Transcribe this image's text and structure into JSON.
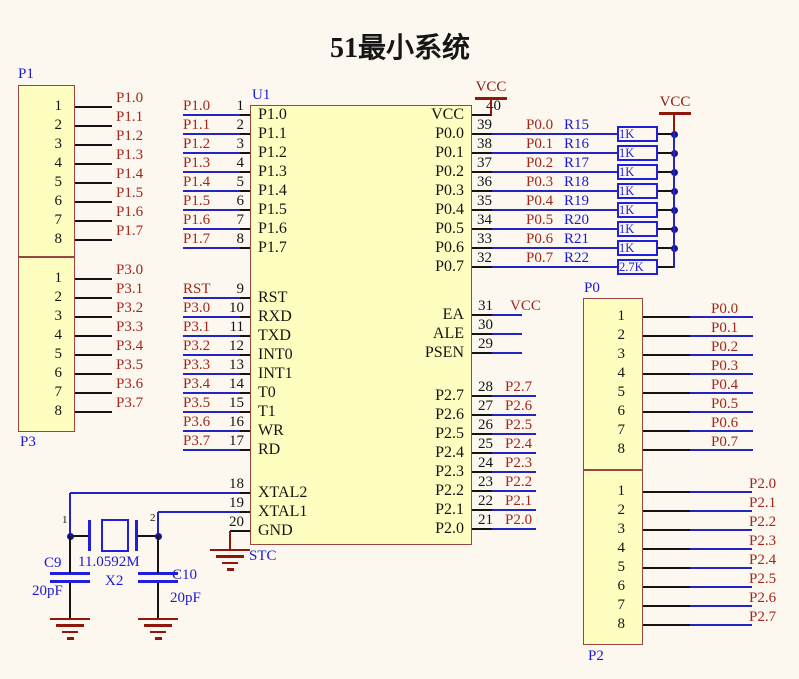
{
  "title": "51最小系统",
  "colors": {
    "background": "#FCF8F0",
    "component_fill": "#FEFEC0",
    "component_border": "#9A4640",
    "wire_blue": "#2424C0",
    "pin_black": "#141414",
    "net_label_red": "#A3261B",
    "designator_blue": "#1A1AD2",
    "power_red": "#8F170C",
    "junction_dot": "#16168E",
    "resistor_blue": "#2020DC",
    "text": "#141414"
  },
  "power": {
    "vcc_label": "VCC"
  },
  "chip": {
    "designator": "U1",
    "part_value": "STC",
    "left_groups": [
      [
        {
          "num": "1",
          "name": "P1.0",
          "net": "P1.0"
        },
        {
          "num": "2",
          "name": "P1.1",
          "net": "P1.1"
        },
        {
          "num": "3",
          "name": "P1.2",
          "net": "P1.2"
        },
        {
          "num": "4",
          "name": "P1.3",
          "net": "P1.3"
        },
        {
          "num": "5",
          "name": "P1.4",
          "net": "P1.4"
        },
        {
          "num": "6",
          "name": "P1.5",
          "net": "P1.5"
        },
        {
          "num": "7",
          "name": "P1.6",
          "net": "P1.6"
        },
        {
          "num": "8",
          "name": "P1.7",
          "net": "P1.7"
        }
      ],
      [
        {
          "num": "9",
          "name": "RST",
          "net": "RST"
        },
        {
          "num": "10",
          "name": "RXD",
          "net": "P3.0"
        },
        {
          "num": "11",
          "name": "TXD",
          "net": "P3.1"
        },
        {
          "num": "12",
          "name": "INT0",
          "net": "P3.2"
        },
        {
          "num": "13",
          "name": "INT1",
          "net": "P3.3"
        },
        {
          "num": "14",
          "name": "T0",
          "net": "P3.4"
        },
        {
          "num": "15",
          "name": "T1",
          "net": "P3.5"
        },
        {
          "num": "16",
          "name": "WR",
          "net": "P3.6"
        },
        {
          "num": "17",
          "name": "RD",
          "net": "P3.7"
        }
      ],
      [
        {
          "num": "18",
          "name": "XTAL2"
        },
        {
          "num": "19",
          "name": "XTAL1"
        },
        {
          "num": "20",
          "name": "GND"
        }
      ]
    ],
    "right_groups": [
      [
        {
          "num": "40",
          "name": "VCC"
        },
        {
          "num": "39",
          "name": "P0.0"
        },
        {
          "num": "38",
          "name": "P0.1"
        },
        {
          "num": "37",
          "name": "P0.2"
        },
        {
          "num": "36",
          "name": "P0.3"
        },
        {
          "num": "35",
          "name": "P0.4"
        },
        {
          "num": "34",
          "name": "P0.5"
        },
        {
          "num": "33",
          "name": "P0.6"
        },
        {
          "num": "32",
          "name": "P0.7"
        }
      ],
      [
        {
          "num": "31",
          "name": "EA",
          "net": "VCC"
        },
        {
          "num": "30",
          "name": "ALE"
        },
        {
          "num": "29",
          "name": "PSEN"
        }
      ],
      [
        {
          "num": "28",
          "name": "P2.7",
          "net": "P2.7"
        },
        {
          "num": "27",
          "name": "P2.6",
          "net": "P2.6"
        },
        {
          "num": "26",
          "name": "P2.5",
          "net": "P2.5"
        },
        {
          "num": "25",
          "name": "P2.4",
          "net": "P2.4"
        },
        {
          "num": "24",
          "name": "P2.3",
          "net": "P2.3"
        },
        {
          "num": "23",
          "name": "P2.2",
          "net": "P2.2"
        },
        {
          "num": "22",
          "name": "P2.1",
          "net": "P2.1"
        },
        {
          "num": "21",
          "name": "P2.0",
          "net": "P2.0"
        }
      ]
    ]
  },
  "resistors": [
    {
      "ref": "R15",
      "value": "1K",
      "net": "P0.0"
    },
    {
      "ref": "R16",
      "value": "1K",
      "net": "P0.1"
    },
    {
      "ref": "R17",
      "value": "1K",
      "net": "P0.2"
    },
    {
      "ref": "R18",
      "value": "1K",
      "net": "P0.3"
    },
    {
      "ref": "R19",
      "value": "1K",
      "net": "P0.4"
    },
    {
      "ref": "R20",
      "value": "1K",
      "net": "P0.5"
    },
    {
      "ref": "R21",
      "value": "1K",
      "net": "P0.6"
    },
    {
      "ref": "R22",
      "value": "2.7K",
      "net": "P0.7"
    }
  ],
  "connectors": [
    {
      "designator": "P1",
      "pins": [
        {
          "num": "1",
          "net": "P1.0"
        },
        {
          "num": "2",
          "net": "P1.1"
        },
        {
          "num": "3",
          "net": "P1.2"
        },
        {
          "num": "4",
          "net": "P1.3"
        },
        {
          "num": "5",
          "net": "P1.4"
        },
        {
          "num": "6",
          "net": "P1.5"
        },
        {
          "num": "7",
          "net": "P1.6"
        },
        {
          "num": "8",
          "net": "P1.7"
        }
      ]
    },
    {
      "designator": "P3",
      "pins": [
        {
          "num": "1",
          "net": "P3.0"
        },
        {
          "num": "2",
          "net": "P3.1"
        },
        {
          "num": "3",
          "net": "P3.2"
        },
        {
          "num": "4",
          "net": "P3.3"
        },
        {
          "num": "5",
          "net": "P3.4"
        },
        {
          "num": "6",
          "net": "P3.5"
        },
        {
          "num": "7",
          "net": "P3.6"
        },
        {
          "num": "8",
          "net": "P3.7"
        }
      ]
    },
    {
      "designator": "P0",
      "pins": [
        {
          "num": "1",
          "net": "P0.0"
        },
        {
          "num": "2",
          "net": "P0.1"
        },
        {
          "num": "3",
          "net": "P0.2"
        },
        {
          "num": "4",
          "net": "P0.3"
        },
        {
          "num": "5",
          "net": "P0.4"
        },
        {
          "num": "6",
          "net": "P0.5"
        },
        {
          "num": "7",
          "net": "P0.6"
        },
        {
          "num": "8",
          "net": "P0.7"
        }
      ]
    },
    {
      "designator": "P2",
      "pins": [
        {
          "num": "1",
          "net": "P2.0"
        },
        {
          "num": "2",
          "net": "P2.1"
        },
        {
          "num": "3",
          "net": "P2.2"
        },
        {
          "num": "4",
          "net": "P2.3"
        },
        {
          "num": "5",
          "net": "P2.4"
        },
        {
          "num": "6",
          "net": "P2.5"
        },
        {
          "num": "7",
          "net": "P2.6"
        },
        {
          "num": "8",
          "net": "P2.7"
        }
      ]
    }
  ],
  "oscillator": {
    "crystal": {
      "designator": "X2",
      "value": "11.0592M",
      "pin1": "1",
      "pin2": "2"
    },
    "cap_left": {
      "designator": "C9",
      "value": "20pF"
    },
    "cap_right": {
      "designator": "C10",
      "value": "20pF"
    }
  }
}
